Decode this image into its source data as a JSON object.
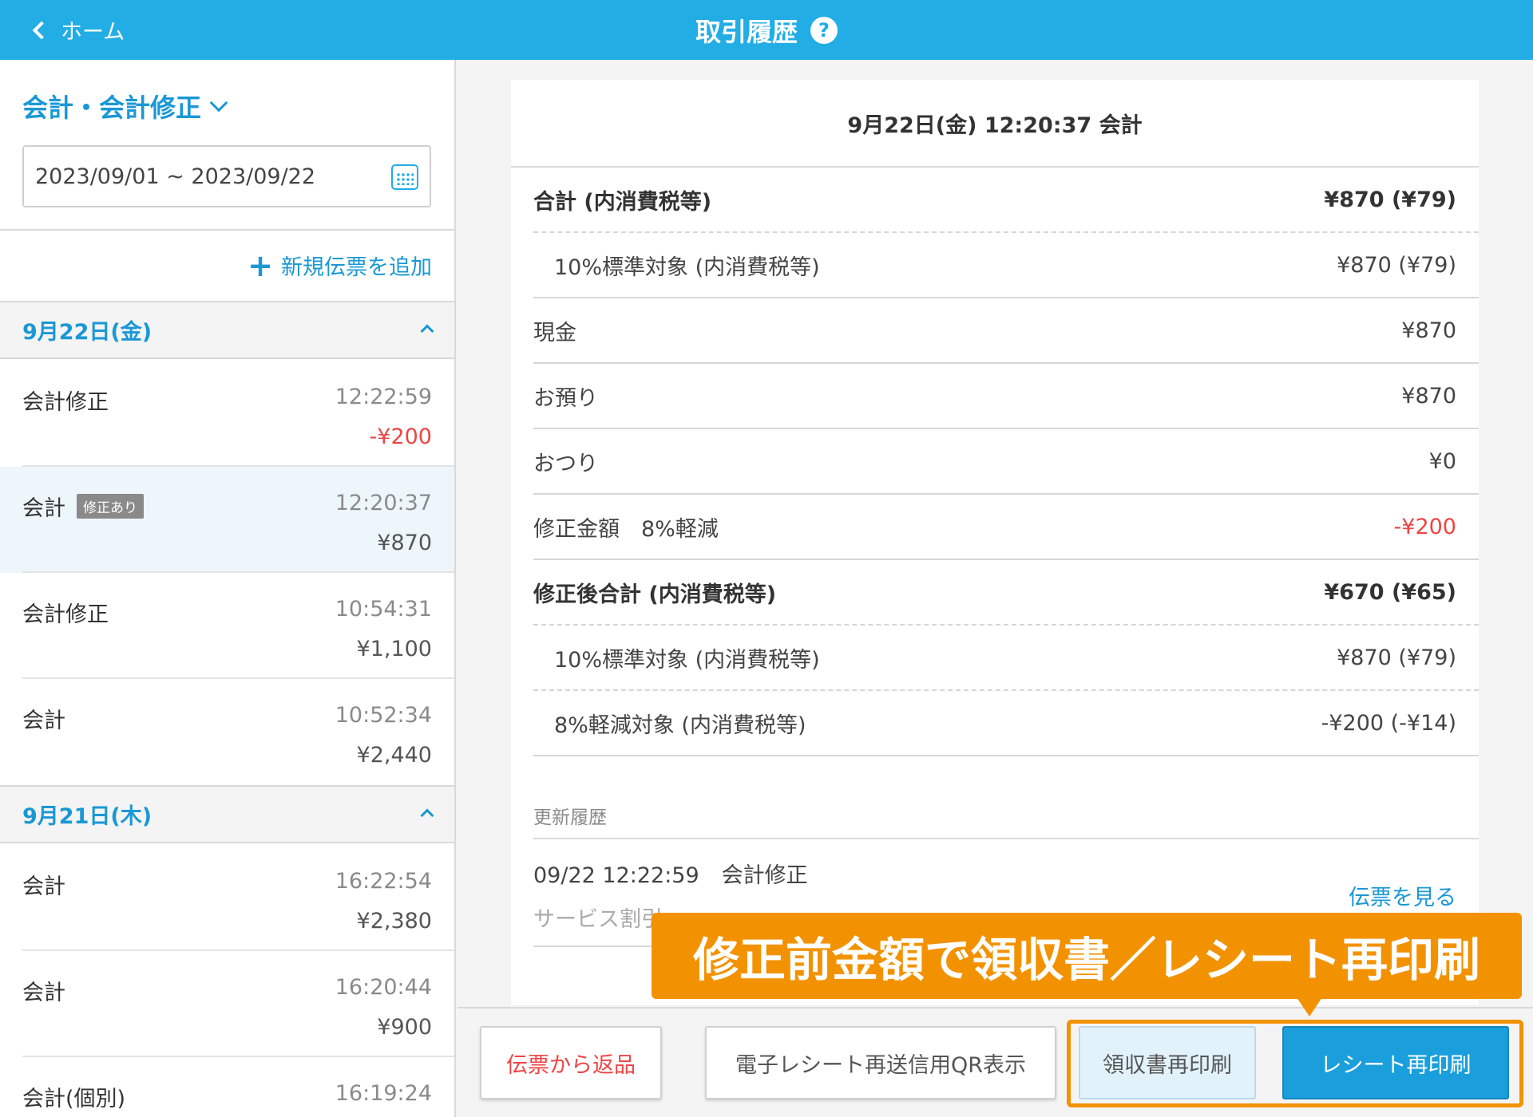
{
  "header": {
    "back_label": "ホーム",
    "title": "取引履歴",
    "help_icon": "?"
  },
  "sidebar": {
    "filter_label": "会計・会計修正",
    "date_range": "2023/09/01 ~ 2023/09/22",
    "add_slip_label": "新規伝票を追加",
    "days": [
      {
        "label": "9月22日(金)",
        "items": [
          {
            "name": "会計修正",
            "badge": "",
            "time": "12:22:59",
            "amount": "-¥200"
          },
          {
            "name": "会計",
            "badge": "修正あり",
            "time": "12:20:37",
            "amount": "¥870"
          },
          {
            "name": "会計修正",
            "badge": "",
            "time": "10:54:31",
            "amount": "¥1,100"
          },
          {
            "name": "会計",
            "badge": "",
            "time": "10:52:34",
            "amount": "¥2,440"
          }
        ]
      },
      {
        "label": "9月21日(木)",
        "items": [
          {
            "name": "会計",
            "badge": "",
            "time": "16:22:54",
            "amount": "¥2,380"
          },
          {
            "name": "会計",
            "badge": "",
            "time": "16:20:44",
            "amount": "¥900"
          },
          {
            "name": "会計(個別)",
            "badge": "",
            "time": "16:19:24",
            "amount": ""
          }
        ]
      }
    ]
  },
  "detail": {
    "title": "9月22日(金) 12:20:37 会計",
    "rows": [
      {
        "label": "合計 (内消費税等)",
        "value": "¥870 (¥79)"
      },
      {
        "label": "10%標準対象 (内消費税等)",
        "value": "¥870 (¥79)"
      },
      {
        "label": "現金",
        "value": "¥870"
      },
      {
        "label": "お預り",
        "value": "¥870"
      },
      {
        "label": "おつり",
        "value": "¥0"
      },
      {
        "label": "修正金額　8%軽減",
        "value": "-¥200"
      },
      {
        "label": "修正後合計 (内消費税等)",
        "value": "¥670 (¥65)"
      },
      {
        "label": "10%標準対象 (内消費税等)",
        "value": "¥870 (¥79)"
      },
      {
        "label": "8%軽減対象 (内消費税等)",
        "value": "-¥200 (-¥14)"
      }
    ],
    "history_label": "更新履歴",
    "history_entry": {
      "datetime": "09/22 12:22:59",
      "type": "会計修正",
      "sub": "サービス割引"
    },
    "view_slip_link": "伝票を見る"
  },
  "actions": {
    "return_label": "伝票から返品",
    "qr_label": "電子レシート再送信用QR表示",
    "receipt_reprint_label": "領収書再印刷",
    "receipt_slip_reprint_label": "レシート再印刷"
  },
  "callout_text": "修正前金額で領収書／レシート再印刷",
  "colors": {
    "header": "#22ade5",
    "accent": "#1a98d5",
    "negative": "#ee4444",
    "callout": "#f39200"
  }
}
